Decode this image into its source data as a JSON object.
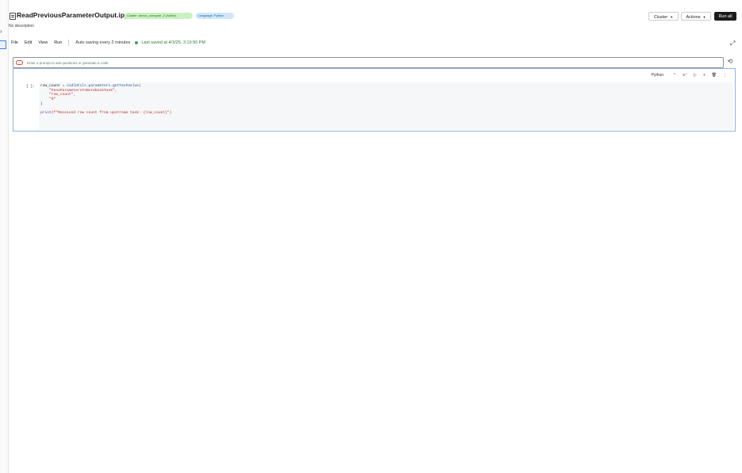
{
  "notebook": {
    "title": "ReadPreviousParameterOutput.ipynb",
    "cluster_badge": "Cluster: deeoc_compute_2 (Active)",
    "language_badge": "Language: Python",
    "description": "No description"
  },
  "toolbar": {
    "cluster_label": "Cluster",
    "actions_label": "Actions",
    "run_all_label": "Run all"
  },
  "menu": {
    "items": [
      "File",
      "Edit",
      "View",
      "Run"
    ],
    "autosave": "Auto saving every 2 minutes",
    "last_saved": "Last saved at 4/3/25, 3:19:50 PM"
  },
  "prompt": {
    "placeholder": "Enter a prompt to ask questions or generate a code"
  },
  "cell": {
    "language": "Python",
    "execution_count": "[ ]:",
    "code": {
      "line1_prefix": "row_count = ",
      "line1_call": "oidlUtils.parameters.getTaskValue(",
      "arg1": "\"PassParametersToNotebookTask\",",
      "arg2": "\"row_count\",",
      "arg3": "\"0\"",
      "close": ")",
      "print_fn": "print",
      "print_arg": "(f\"Received row count from upstream task: {row_count}\")"
    }
  },
  "colors": {
    "accent_green": "#3fa34d",
    "cell_border": "#8fb6df",
    "run_all_bg": "#1b1b1b"
  },
  "icons": {
    "notebook": "notebook-icon",
    "expand": "expand-icon",
    "prompt": "ai-prompt-icon",
    "run": "run-cell-icon",
    "add": "add-cell-icon",
    "delete": "trash-icon",
    "more": "more-icon"
  }
}
